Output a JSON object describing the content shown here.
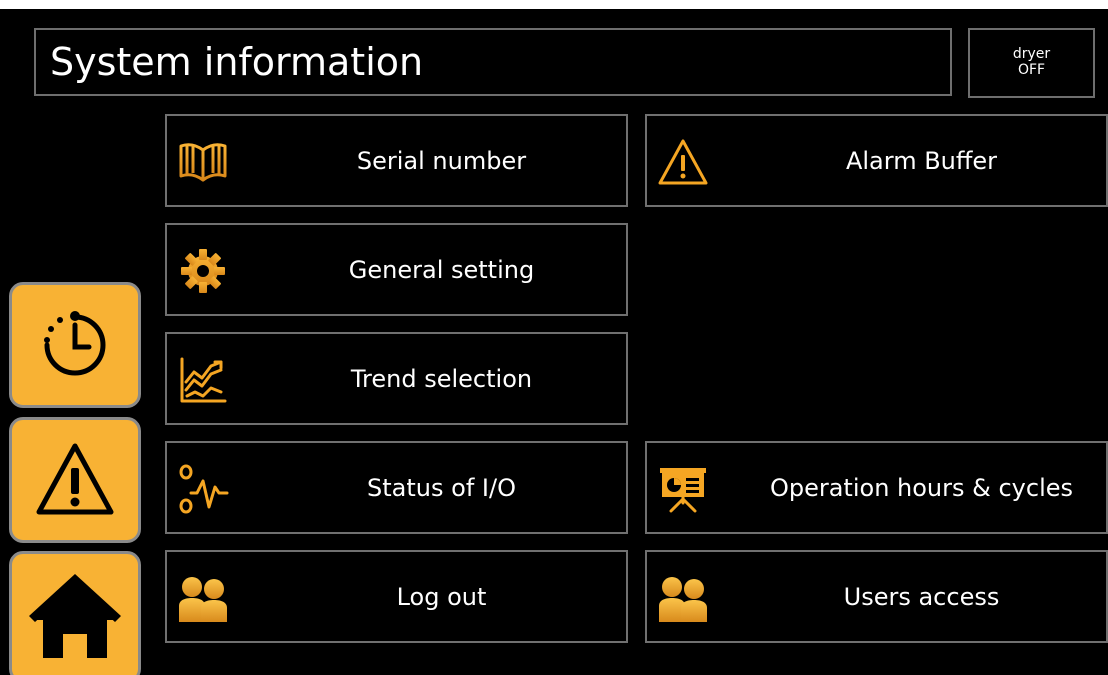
{
  "header": {
    "title": "System information",
    "dryer_label": "dryer",
    "dryer_state": "OFF"
  },
  "menu": {
    "serial_number": "Serial number",
    "alarm_buffer": "Alarm Buffer",
    "general_setting": "General setting",
    "trend_selection": "Trend selection",
    "status_io": "Status of I/O",
    "operation_hours": "Operation hours & cycles",
    "log_out": "Log out",
    "users_access": "Users access"
  },
  "sidebar": {
    "items": [
      {
        "icon": "timer-icon"
      },
      {
        "icon": "alarm-warning-icon"
      },
      {
        "icon": "home-icon"
      }
    ]
  },
  "colors": {
    "background": "#000000",
    "accent": "#f8b234",
    "icon_orange": "#f5a623",
    "border": "#707070",
    "text": "#ffffff"
  }
}
